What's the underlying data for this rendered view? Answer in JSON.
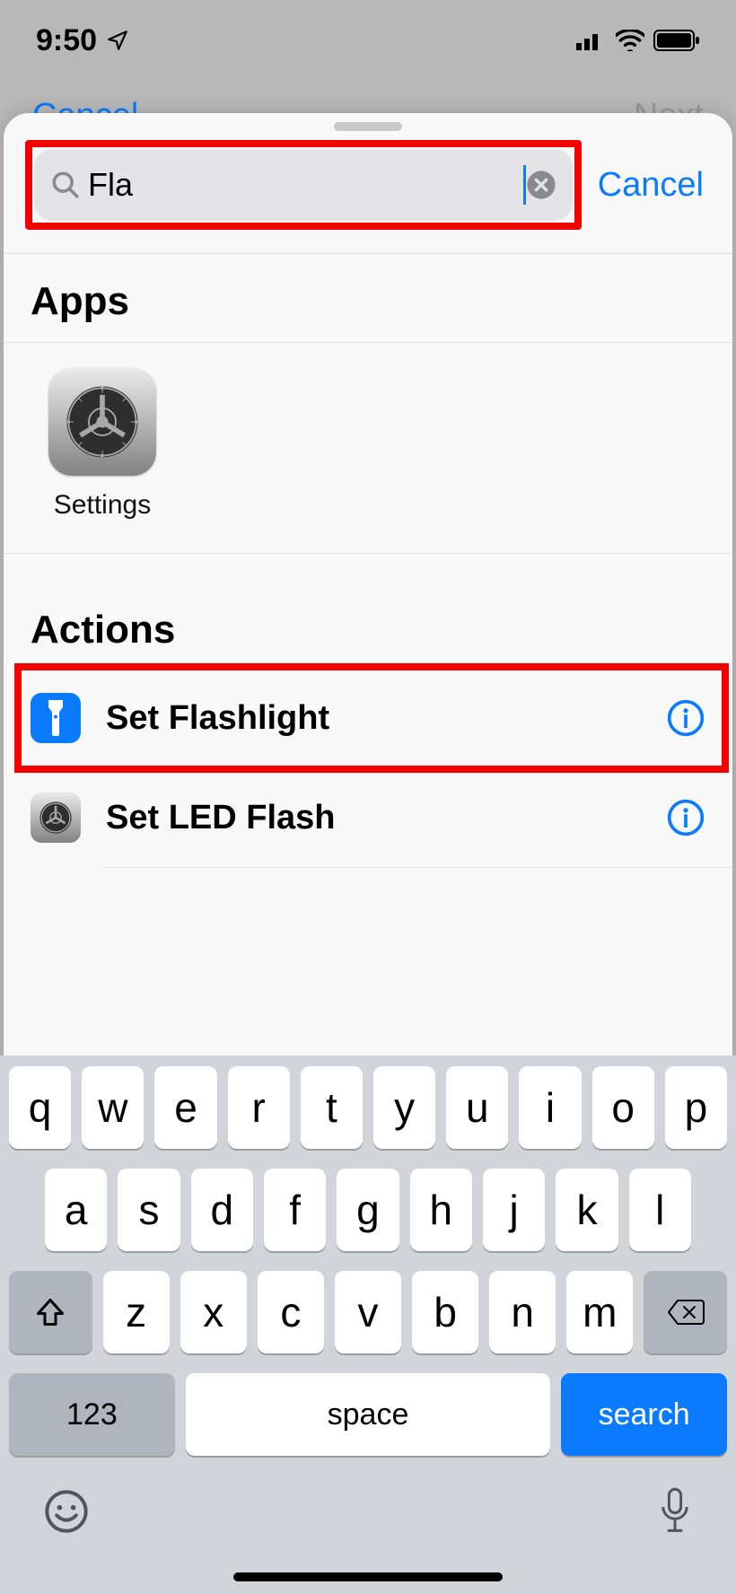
{
  "status": {
    "time": "9:50"
  },
  "underlying": {
    "left": "Cancel",
    "right": "Next"
  },
  "search": {
    "value": "Fla",
    "cancel": "Cancel"
  },
  "sections": {
    "apps_title": "Apps",
    "actions_title": "Actions"
  },
  "apps": [
    {
      "name": "Settings"
    }
  ],
  "actions": [
    {
      "title": "Set Flashlight",
      "icon": "flashlight",
      "highlighted": true
    },
    {
      "title": "Set LED Flash",
      "icon": "settings",
      "highlighted": false
    }
  ],
  "keyboard": {
    "row1": [
      "q",
      "w",
      "e",
      "r",
      "t",
      "y",
      "u",
      "i",
      "o",
      "p"
    ],
    "row2": [
      "a",
      "s",
      "d",
      "f",
      "g",
      "h",
      "j",
      "k",
      "l"
    ],
    "row3": [
      "z",
      "x",
      "c",
      "v",
      "b",
      "n",
      "m"
    ],
    "num": "123",
    "space": "space",
    "search": "search"
  }
}
